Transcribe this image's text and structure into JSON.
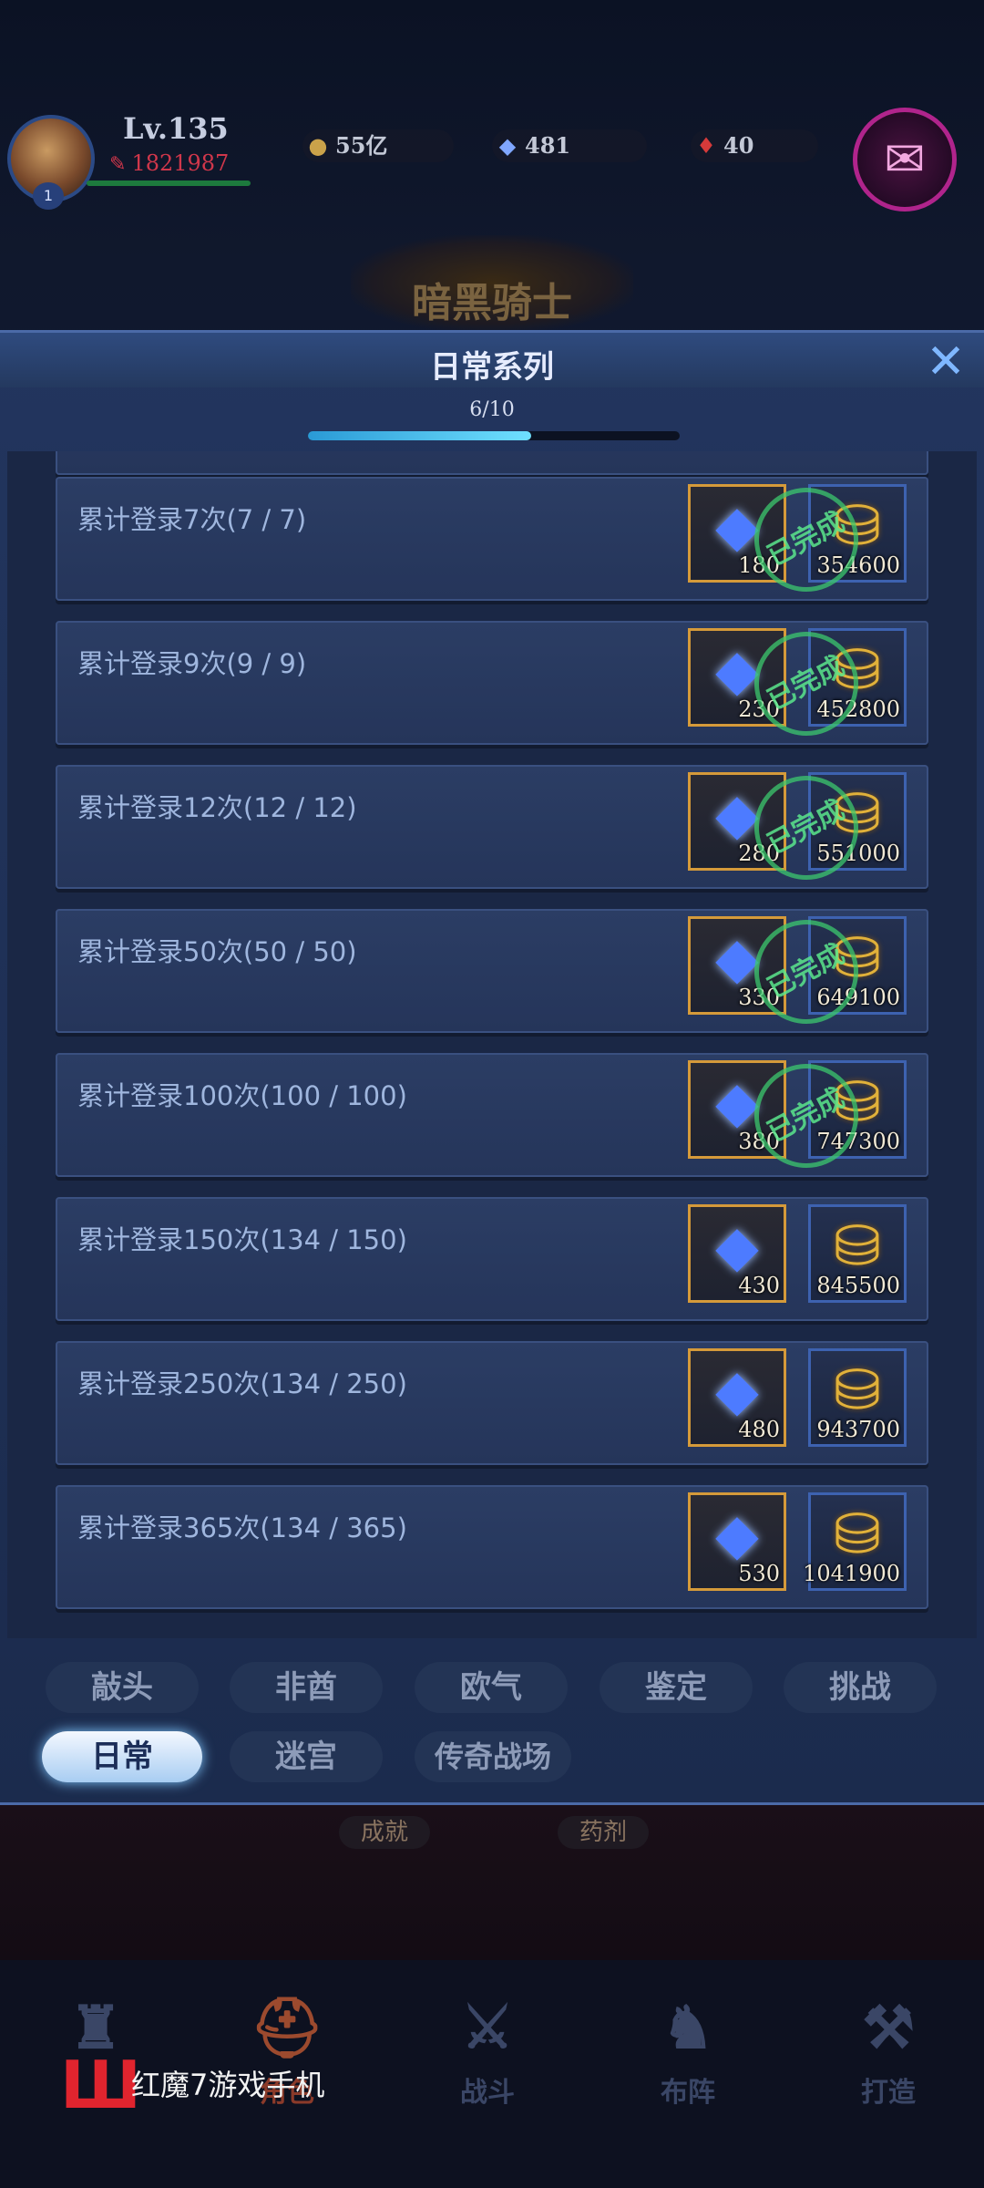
{
  "player": {
    "level": "Lv.135",
    "power": "1821987",
    "avatar_badge": "1",
    "gold": "55亿",
    "diamonds": "481",
    "rubies": "40"
  },
  "header_emblem": "暗黑骑士",
  "dialog": {
    "title": "日常系列",
    "close_icon": "close-icon",
    "progress": {
      "label": "6/10",
      "fraction": 0.6
    }
  },
  "achievements": [
    {
      "label": "累计登录7次(7 / 7)",
      "diamond": "180",
      "gold": "354600",
      "completed": true
    },
    {
      "label": "累计登录9次(9 / 9)",
      "diamond": "230",
      "gold": "452800",
      "completed": true
    },
    {
      "label": "累计登录12次(12 / 12)",
      "diamond": "280",
      "gold": "551000",
      "completed": true
    },
    {
      "label": "累计登录50次(50 / 50)",
      "diamond": "330",
      "gold": "649100",
      "completed": true
    },
    {
      "label": "累计登录100次(100 / 100)",
      "diamond": "380",
      "gold": "747300",
      "completed": true
    },
    {
      "label": "累计登录150次(134 / 150)",
      "diamond": "430",
      "gold": "845500",
      "completed": false
    },
    {
      "label": "累计登录250次(134 / 250)",
      "diamond": "480",
      "gold": "943700",
      "completed": false
    },
    {
      "label": "累计登录365次(134 / 365)",
      "diamond": "530",
      "gold": "1041900",
      "completed": false
    }
  ],
  "completed_stamp": "已完成",
  "category_tabs": [
    "敲头",
    "非酋",
    "欧气",
    "鉴定",
    "挑战",
    "日常",
    "迷宫",
    "传奇战场"
  ],
  "active_tab": "日常",
  "below_tags": [
    "成就",
    "药剂"
  ],
  "bottom_nav": [
    "",
    "角色",
    "战斗",
    "布阵",
    "打造"
  ],
  "phone_brand": "红魔7游戏手机",
  "colors": {
    "accent": "#6fe0ff",
    "diamond_frame": "#d59a3a",
    "gold_frame": "#3d62b0",
    "stamp": "#3cc86e"
  }
}
